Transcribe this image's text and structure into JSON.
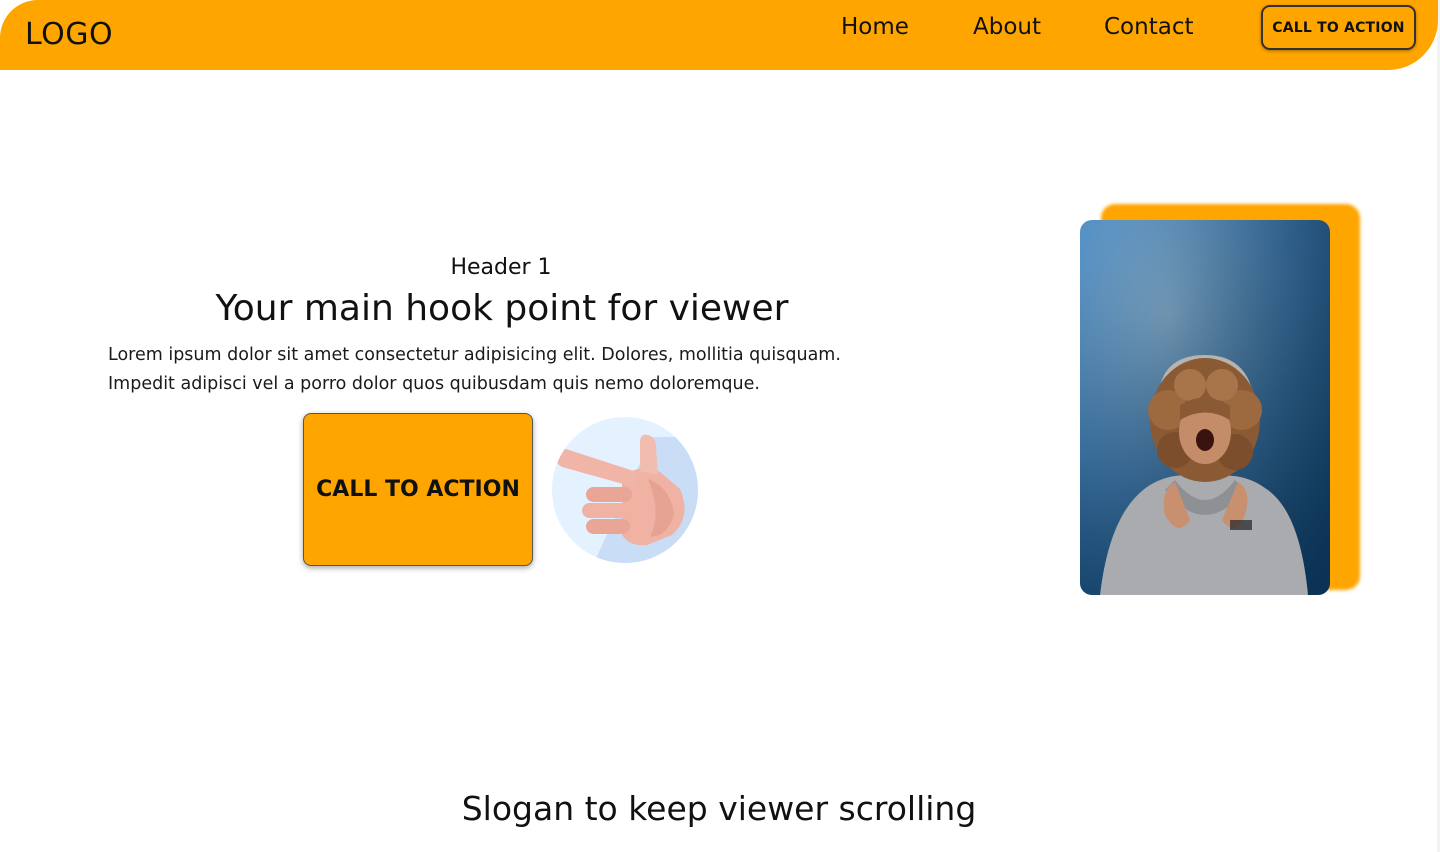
{
  "nav": {
    "logo": "LOGO",
    "links": [
      "Home",
      "About",
      "Contact"
    ],
    "cta_label": "CALL TO ACTION"
  },
  "hero": {
    "subheader": "Header 1",
    "title": "Your main hook point for viewer",
    "text_line1": "Lorem ipsum dolor sit amet consectetur adipisicing elit. Dolores, mollitia quisquam.",
    "text_line2": "Impedit adipisci vel a porro dolor quos quibusdam quis nemo doloremque.",
    "cta_label": "CALL TO ACTION"
  },
  "slogan": "Slogan to keep viewer scrolling",
  "colors": {
    "accent": "#FFA500",
    "text": "#111111",
    "background": "#FFFFFF",
    "photo_bg": "#4A8BC4"
  },
  "icons": {
    "hand": "pointing-hand-icon"
  }
}
